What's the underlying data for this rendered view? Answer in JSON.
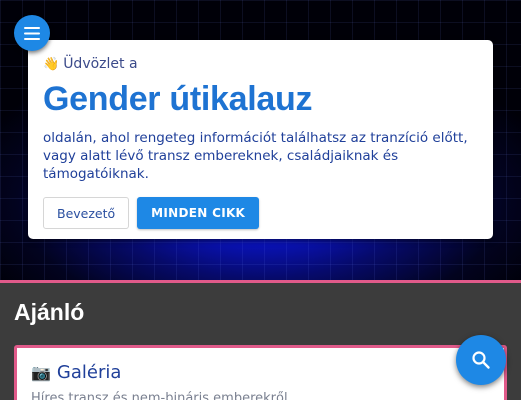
{
  "hero": {
    "greeting_emoji": "👋",
    "greeting": "Üdvözlet a",
    "title": "Gender útikalauz",
    "description": "oldalán, ahol rengeteg információt találhatsz az tranzíció előtt, vagy alatt lévő transz embereknek, családjaiknak és támogatóiknak.",
    "buttons": {
      "intro": "Bevezető",
      "all_articles": "MINDEN CIKK"
    }
  },
  "menu_button": {
    "icon": "hamburger-menu-icon"
  },
  "search_button": {
    "icon": "search-icon"
  },
  "featured": {
    "title": "Ajánló",
    "card": {
      "icon": "📷",
      "title": "Galéria",
      "subtitle": "Híres transz és nem-bináris emberekről"
    }
  },
  "colors": {
    "accent": "#1e88e5",
    "heading": "#1e73d2",
    "text": "#20409a",
    "pink_border": "#e05a8a",
    "section_bg": "#3c3c3c"
  }
}
